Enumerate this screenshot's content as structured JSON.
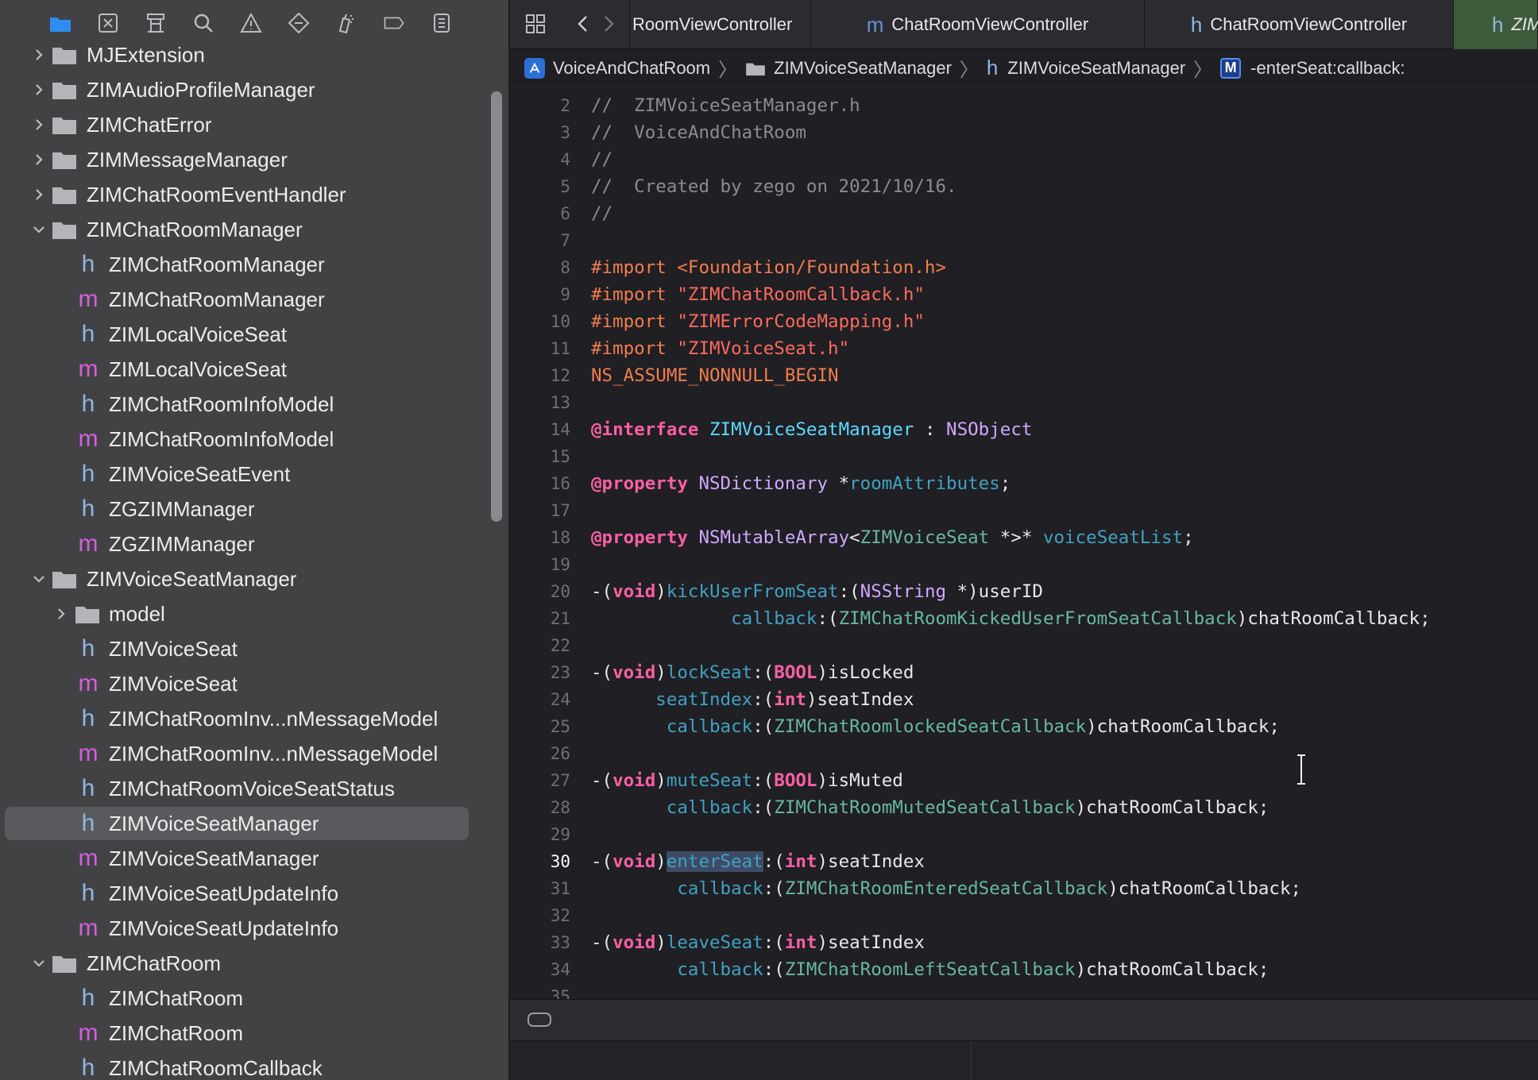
{
  "navigator": {
    "toolbar_icons": [
      "folder-icon",
      "source-control-icon",
      "symbol-hierarchy-icon",
      "find-icon",
      "warning-icon",
      "test-diamond-icon",
      "debug-spray-icon",
      "breakpoint-icon",
      "report-icon"
    ],
    "tree": [
      {
        "kind": "folder",
        "depth": 0,
        "expanded": false,
        "label": "MJExtension"
      },
      {
        "kind": "folder",
        "depth": 0,
        "expanded": false,
        "label": "ZIMAudioProfileManager"
      },
      {
        "kind": "folder",
        "depth": 0,
        "expanded": false,
        "label": "ZIMChatError"
      },
      {
        "kind": "folder",
        "depth": 0,
        "expanded": false,
        "label": "ZIMMessageManager"
      },
      {
        "kind": "folder",
        "depth": 0,
        "expanded": false,
        "label": "ZIMChatRoomEventHandler"
      },
      {
        "kind": "folder",
        "depth": 0,
        "expanded": true,
        "label": "ZIMChatRoomManager"
      },
      {
        "kind": "h",
        "depth": 1,
        "label": "ZIMChatRoomManager"
      },
      {
        "kind": "m",
        "depth": 1,
        "label": "ZIMChatRoomManager"
      },
      {
        "kind": "h",
        "depth": 1,
        "label": "ZIMLocalVoiceSeat"
      },
      {
        "kind": "m",
        "depth": 1,
        "label": "ZIMLocalVoiceSeat"
      },
      {
        "kind": "h",
        "depth": 1,
        "label": "ZIMChatRoomInfoModel"
      },
      {
        "kind": "m",
        "depth": 1,
        "label": "ZIMChatRoomInfoModel"
      },
      {
        "kind": "h",
        "depth": 1,
        "label": "ZIMVoiceSeatEvent"
      },
      {
        "kind": "h",
        "depth": 1,
        "label": "ZGZIMManager"
      },
      {
        "kind": "m",
        "depth": 1,
        "label": "ZGZIMManager"
      },
      {
        "kind": "folder",
        "depth": 0,
        "expanded": true,
        "label": "ZIMVoiceSeatManager"
      },
      {
        "kind": "folder",
        "depth": 1,
        "expanded": false,
        "label": "model"
      },
      {
        "kind": "h",
        "depth": 1,
        "label": "ZIMVoiceSeat"
      },
      {
        "kind": "m",
        "depth": 1,
        "label": "ZIMVoiceSeat"
      },
      {
        "kind": "h",
        "depth": 1,
        "label": "ZIMChatRoomInv...nMessageModel"
      },
      {
        "kind": "m",
        "depth": 1,
        "label": "ZIMChatRoomInv...nMessageModel"
      },
      {
        "kind": "h",
        "depth": 1,
        "label": "ZIMChatRoomVoiceSeatStatus"
      },
      {
        "kind": "h",
        "depth": 1,
        "label": "ZIMVoiceSeatManager",
        "selected": true
      },
      {
        "kind": "m",
        "depth": 1,
        "label": "ZIMVoiceSeatManager"
      },
      {
        "kind": "h",
        "depth": 1,
        "label": "ZIMVoiceSeatUpdateInfo"
      },
      {
        "kind": "m",
        "depth": 1,
        "label": "ZIMVoiceSeatUpdateInfo"
      },
      {
        "kind": "folder",
        "depth": 0,
        "expanded": true,
        "label": "ZIMChatRoom"
      },
      {
        "kind": "h",
        "depth": 1,
        "label": "ZIMChatRoom"
      },
      {
        "kind": "m",
        "depth": 1,
        "label": "ZIMChatRoom"
      },
      {
        "kind": "h",
        "depth": 1,
        "label": "ZIMChatRoomCallback"
      }
    ]
  },
  "tabs": [
    {
      "icon": "",
      "label": "RoomViewController",
      "active": false
    },
    {
      "icon": "m",
      "label": "ChatRoomViewController",
      "active": false
    },
    {
      "icon": "h",
      "label": "ChatRoomViewController",
      "active": false
    },
    {
      "icon": "h",
      "label": "ZIM",
      "active": true
    }
  ],
  "jumpbar": {
    "project": "VoiceAndChatRoom",
    "group": "ZIMVoiceSeatManager",
    "file": "ZIMVoiceSeatManager",
    "method_badge": "M",
    "method": "-enterSeat:callback:"
  },
  "editor": {
    "current_line": "30",
    "lines": [
      {
        "n": "2",
        "t": [
          [
            "c-comment",
            "//  ZIMVoiceSeatManager.h"
          ]
        ]
      },
      {
        "n": "3",
        "t": [
          [
            "c-comment",
            "//  VoiceAndChatRoom"
          ]
        ]
      },
      {
        "n": "4",
        "t": [
          [
            "c-comment",
            "//"
          ]
        ]
      },
      {
        "n": "5",
        "t": [
          [
            "c-comment",
            "//  Created by zego on 2021/10/16."
          ]
        ]
      },
      {
        "n": "6",
        "t": [
          [
            "c-comment",
            "//"
          ]
        ]
      },
      {
        "n": "7",
        "t": []
      },
      {
        "n": "8",
        "t": [
          [
            "c-pre",
            "#import <Foundation/Foundation.h>"
          ]
        ]
      },
      {
        "n": "9",
        "t": [
          [
            "c-pre",
            "#import "
          ],
          [
            "c-str",
            "\"ZIMChatRoomCallback.h\""
          ]
        ]
      },
      {
        "n": "10",
        "t": [
          [
            "c-pre",
            "#import "
          ],
          [
            "c-str",
            "\"ZIMErrorCodeMapping.h\""
          ]
        ]
      },
      {
        "n": "11",
        "t": [
          [
            "c-pre",
            "#import "
          ],
          [
            "c-str",
            "\"ZIMVoiceSeat.h\""
          ]
        ]
      },
      {
        "n": "12",
        "t": [
          [
            "c-pre",
            "NS_ASSUME_NONNULL_BEGIN"
          ]
        ]
      },
      {
        "n": "13",
        "t": []
      },
      {
        "n": "14",
        "t": [
          [
            "c-kw",
            "@interface"
          ],
          [
            "",
            " "
          ],
          [
            "c-cls",
            "ZIMVoiceSeatManager"
          ],
          [
            "",
            " : "
          ],
          [
            "c-type",
            "NSObject"
          ]
        ]
      },
      {
        "n": "15",
        "t": []
      },
      {
        "n": "16",
        "t": [
          [
            "c-kw",
            "@property"
          ],
          [
            "",
            " "
          ],
          [
            "c-type",
            "NSDictionary"
          ],
          [
            "",
            " *"
          ],
          [
            "c-prop",
            "roomAttributes"
          ],
          [
            "",
            ";"
          ]
        ]
      },
      {
        "n": "17",
        "t": []
      },
      {
        "n": "18",
        "t": [
          [
            "c-kw",
            "@property"
          ],
          [
            "",
            " "
          ],
          [
            "c-type",
            "NSMutableArray"
          ],
          [
            "",
            "<"
          ],
          [
            "c-sel",
            "ZIMVoiceSeat"
          ],
          [
            "",
            " *>* "
          ],
          [
            "c-prop",
            "voiceSeatList"
          ],
          [
            "",
            ";"
          ]
        ]
      },
      {
        "n": "19",
        "t": []
      },
      {
        "n": "20",
        "t": [
          [
            "",
            "-("
          ],
          [
            "c-kw",
            "void"
          ],
          [
            "",
            ")"
          ],
          [
            "c-selname",
            "kickUserFromSeat"
          ],
          [
            "",
            ":("
          ],
          [
            "c-type",
            "NSString"
          ],
          [
            "",
            " *)userID"
          ]
        ]
      },
      {
        "n": "21",
        "t": [
          [
            "",
            "             "
          ],
          [
            "c-selname",
            "callback"
          ],
          [
            "",
            ":("
          ],
          [
            "c-sel",
            "ZIMChatRoomKickedUserFromSeatCallback"
          ],
          [
            "",
            ")chatRoomCallback;"
          ]
        ]
      },
      {
        "n": "22",
        "t": []
      },
      {
        "n": "23",
        "t": [
          [
            "",
            "-("
          ],
          [
            "c-kw",
            "void"
          ],
          [
            "",
            ")"
          ],
          [
            "c-selname",
            "lockSeat"
          ],
          [
            "",
            ":("
          ],
          [
            "c-kw",
            "BOOL"
          ],
          [
            "",
            ")isLocked"
          ]
        ]
      },
      {
        "n": "24",
        "t": [
          [
            "",
            "      "
          ],
          [
            "c-selname",
            "seatIndex"
          ],
          [
            "",
            ":("
          ],
          [
            "c-kw",
            "int"
          ],
          [
            "",
            ")seatIndex"
          ]
        ]
      },
      {
        "n": "25",
        "t": [
          [
            "",
            "       "
          ],
          [
            "c-selname",
            "callback"
          ],
          [
            "",
            ":("
          ],
          [
            "c-sel",
            "ZIMChatRoomlockedSeatCallback"
          ],
          [
            "",
            ")chatRoomCallback;"
          ]
        ]
      },
      {
        "n": "26",
        "t": []
      },
      {
        "n": "27",
        "t": [
          [
            "",
            "-("
          ],
          [
            "c-kw",
            "void"
          ],
          [
            "",
            ")"
          ],
          [
            "c-selname",
            "muteSeat"
          ],
          [
            "",
            ":("
          ],
          [
            "c-kw",
            "BOOL"
          ],
          [
            "",
            ")isMuted"
          ]
        ]
      },
      {
        "n": "28",
        "t": [
          [
            "",
            "       "
          ],
          [
            "c-selname",
            "callback"
          ],
          [
            "",
            ":("
          ],
          [
            "c-sel",
            "ZIMChatRoomMutedSeatCallback"
          ],
          [
            "",
            ")chatRoomCallback;"
          ]
        ]
      },
      {
        "n": "29",
        "t": []
      },
      {
        "n": "30",
        "t": [
          [
            "",
            "-("
          ],
          [
            "c-kw",
            "void"
          ],
          [
            "",
            ")"
          ],
          [
            "c-selname hl",
            "enterSeat"
          ],
          [
            "",
            ":("
          ],
          [
            "c-kw",
            "int"
          ],
          [
            "",
            ")seatIndex"
          ]
        ]
      },
      {
        "n": "31",
        "t": [
          [
            "",
            "        "
          ],
          [
            "c-selname",
            "callback"
          ],
          [
            "",
            ":("
          ],
          [
            "c-sel",
            "ZIMChatRoomEnteredSeatCallback"
          ],
          [
            "",
            ")chatRoomCallback;"
          ]
        ]
      },
      {
        "n": "32",
        "t": []
      },
      {
        "n": "33",
        "t": [
          [
            "",
            "-("
          ],
          [
            "c-kw",
            "void"
          ],
          [
            "",
            ")"
          ],
          [
            "c-selname",
            "leaveSeat"
          ],
          [
            "",
            ":("
          ],
          [
            "c-kw",
            "int"
          ],
          [
            "",
            ")seatIndex"
          ]
        ]
      },
      {
        "n": "34",
        "t": [
          [
            "",
            "        "
          ],
          [
            "c-selname",
            "callback"
          ],
          [
            "",
            ":("
          ],
          [
            "c-sel",
            "ZIMChatRoomLeftSeatCallback"
          ],
          [
            "",
            ")chatRoomCallback;"
          ]
        ]
      },
      {
        "n": "35",
        "t": []
      }
    ]
  }
}
